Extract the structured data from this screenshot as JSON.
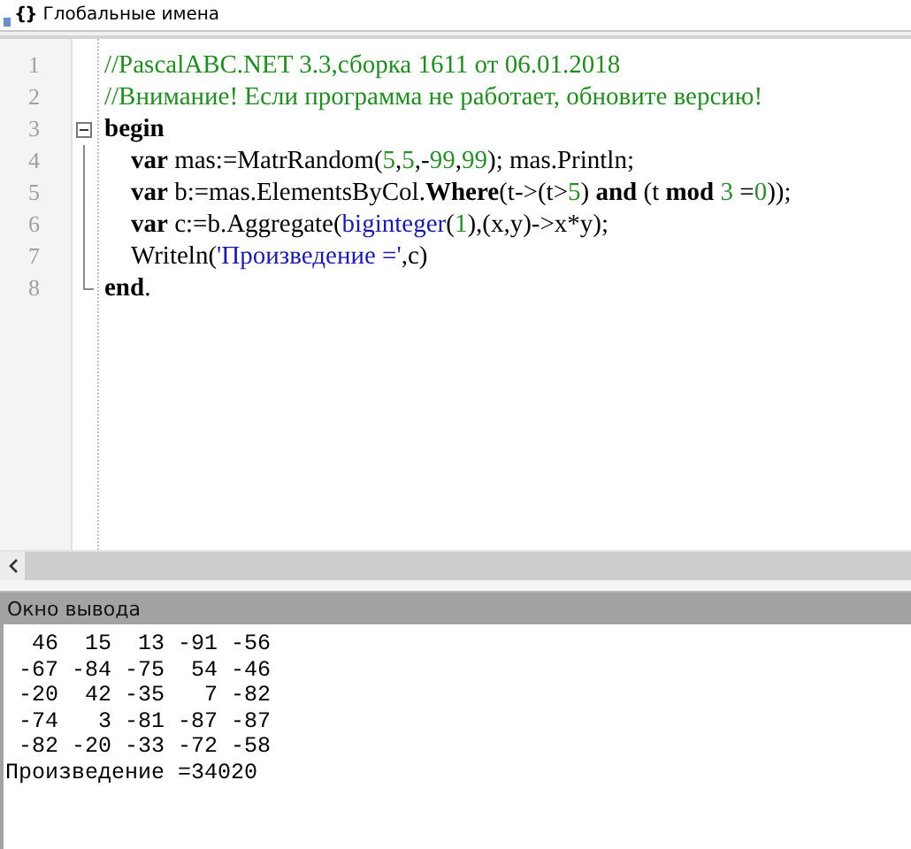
{
  "top_bar": {
    "icon_text": "{}",
    "label": "Глобальные имена"
  },
  "editor": {
    "lines": [
      {
        "number": "1",
        "kind": "plain",
        "tokens": [
          {
            "kind": "comment",
            "text": "//PascalABC.NET 3.3,сборка 1611 от 06.01.2018"
          }
        ]
      },
      {
        "number": "2",
        "kind": "plain",
        "tokens": [
          {
            "kind": "comment",
            "text": "//Внимание! Если программа не работает, обновите версию!"
          }
        ]
      },
      {
        "number": "3",
        "kind": "start",
        "tokens": [
          {
            "kind": "keyword",
            "text": "begin"
          }
        ]
      },
      {
        "number": "4",
        "kind": "inside",
        "tokens": [
          {
            "kind": "keyword",
            "text": "var"
          },
          {
            "kind": "plain",
            "text": " mas:=MatrRandom("
          },
          {
            "kind": "number",
            "text": "5"
          },
          {
            "kind": "plain",
            "text": ","
          },
          {
            "kind": "number",
            "text": "5"
          },
          {
            "kind": "plain",
            "text": ",-"
          },
          {
            "kind": "number",
            "text": "99"
          },
          {
            "kind": "plain",
            "text": ","
          },
          {
            "kind": "number",
            "text": "99"
          },
          {
            "kind": "plain",
            "text": "); mas.Println;"
          }
        ]
      },
      {
        "number": "5",
        "kind": "inside",
        "tokens": [
          {
            "kind": "keyword",
            "text": "var"
          },
          {
            "kind": "plain",
            "text": " b:=mas.ElementsByCol."
          },
          {
            "kind": "keyword",
            "text": "Where"
          },
          {
            "kind": "plain",
            "text": "(t->(t>"
          },
          {
            "kind": "number",
            "text": "5"
          },
          {
            "kind": "plain",
            "text": ") "
          },
          {
            "kind": "keyword",
            "text": "and"
          },
          {
            "kind": "plain",
            "text": " (t "
          },
          {
            "kind": "keyword",
            "text": "mod"
          },
          {
            "kind": "number",
            "text": " 3"
          },
          {
            "kind": "plain",
            "text": " ="
          },
          {
            "kind": "number",
            "text": "0"
          },
          {
            "kind": "plain",
            "text": "));"
          }
        ]
      },
      {
        "number": "6",
        "kind": "inside",
        "tokens": [
          {
            "kind": "keyword",
            "text": "var"
          },
          {
            "kind": "plain",
            "text": " c:=b.Aggregate("
          },
          {
            "kind": "builtin",
            "text": "biginteger"
          },
          {
            "kind": "plain",
            "text": "("
          },
          {
            "kind": "number",
            "text": "1"
          },
          {
            "kind": "plain",
            "text": "),(x,y)->x*y);"
          }
        ]
      },
      {
        "number": "7",
        "kind": "inside",
        "tokens": [
          {
            "kind": "plain",
            "text": "Writeln("
          },
          {
            "kind": "string",
            "text": "'Произведение ='"
          },
          {
            "kind": "plain",
            "text": ",c)"
          }
        ]
      },
      {
        "number": "8",
        "kind": "end",
        "tokens": [
          {
            "kind": "keyword",
            "text": "end"
          },
          {
            "kind": "plain",
            "text": "."
          }
        ]
      }
    ]
  },
  "output": {
    "title": "Окно вывода",
    "lines": [
      "  46  15  13 -91 -56",
      " -67 -84 -75  54 -46",
      " -20  42 -35   7 -82",
      " -74   3 -81 -87 -87",
      " -82 -20 -33 -72 -58",
      "Произведение =34020"
    ]
  }
}
